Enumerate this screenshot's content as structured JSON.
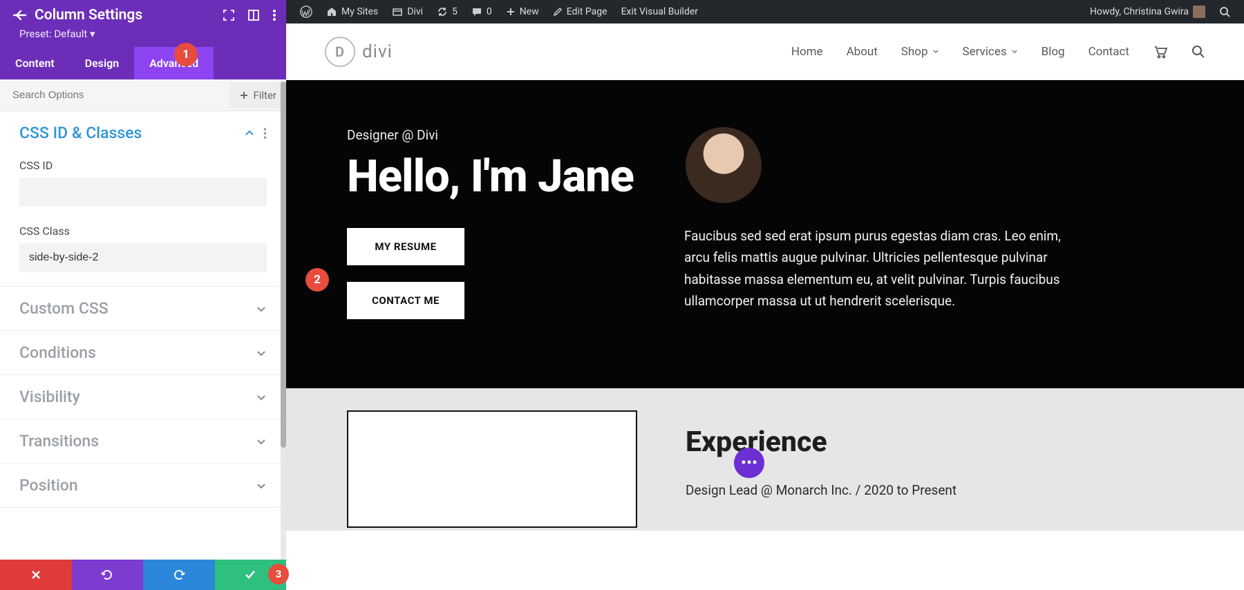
{
  "panel": {
    "title": "Column Settings",
    "preset": "Preset: Default ▾",
    "tabs": {
      "content": "Content",
      "design": "Design",
      "advanced": "Advanced"
    },
    "search_placeholder": "Search Options",
    "filter_label": "Filter",
    "sections": {
      "css_id_classes": {
        "title": "CSS ID & Classes",
        "css_id_label": "CSS ID",
        "css_id_value": "",
        "css_class_label": "CSS Class",
        "css_class_value": "side-by-side-2"
      },
      "custom_css": "Custom CSS",
      "conditions": "Conditions",
      "visibility": "Visibility",
      "transitions": "Transitions",
      "position": "Position"
    }
  },
  "callouts": {
    "one": "1",
    "two": "2",
    "three": "3"
  },
  "adminbar": {
    "my_sites": "My Sites",
    "divi": "Divi",
    "updates": "5",
    "comments": "0",
    "new": "New",
    "edit_page": "Edit Page",
    "exit_vb": "Exit Visual Builder",
    "howdy": "Howdy, Christina Gwira"
  },
  "site": {
    "logo_text": "divi",
    "nav": {
      "home": "Home",
      "about": "About",
      "shop": "Shop",
      "services": "Services",
      "blog": "Blog",
      "contact": "Contact"
    }
  },
  "hero": {
    "kicker": "Designer @ Divi",
    "title": "Hello, I'm Jane",
    "btn_resume": "MY RESUME",
    "btn_contact": "CONTACT ME",
    "paragraph": "Faucibus sed sed erat ipsum purus egestas diam cras. Leo enim, arcu felis mattis augue pulvinar. Ultricies pellentesque pulvinar habitasse massa elementum eu, at velit pulvinar. Turpis faucibus ullamcorper massa ut ut hendrerit scelerisque."
  },
  "experience": {
    "title": "Experience",
    "meta": "Design Lead  @  Monarch Inc.  /  2020 to Present"
  },
  "float_dots": "•••"
}
